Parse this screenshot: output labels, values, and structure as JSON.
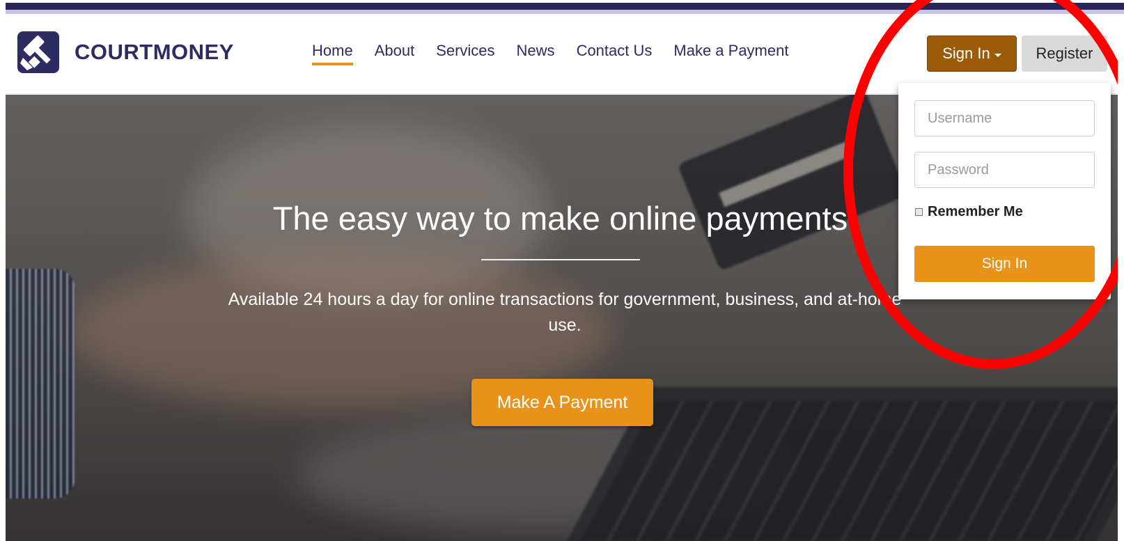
{
  "brand": {
    "name": "COURTMONEY",
    "primary_color": "#2e2a62",
    "accent_color": "#e8921a",
    "logo_icon": "gavel-icon"
  },
  "nav": {
    "items": [
      {
        "label": "Home",
        "active": true
      },
      {
        "label": "About",
        "active": false
      },
      {
        "label": "Services",
        "active": false
      },
      {
        "label": "News",
        "active": false
      },
      {
        "label": "Contact Us",
        "active": false
      },
      {
        "label": "Make a Payment",
        "active": false
      }
    ]
  },
  "auth": {
    "signin_label": "Sign In",
    "signin_color": "#9c5b08",
    "register_label": "Register",
    "dropdown": {
      "username_placeholder": "Username",
      "password_placeholder": "Password",
      "remember_label": "Remember Me",
      "remember_checked": false,
      "submit_label": "Sign In"
    }
  },
  "hero": {
    "title": "The easy way to make online payments.",
    "subtitle": "Available 24 hours a day for online transactions for government, business, and at-home use.",
    "cta_label": "Make A Payment"
  },
  "annotation": {
    "color": "#ff0000",
    "shape": "ellipse"
  }
}
